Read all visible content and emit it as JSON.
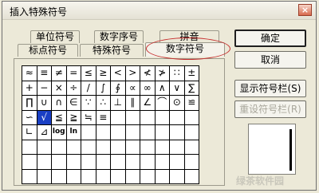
{
  "dialog": {
    "title": "插入特殊符号",
    "close_label": "×"
  },
  "tabs": [
    {
      "label": "单位符号"
    },
    {
      "label": "数字序号"
    },
    {
      "label": "拼音"
    },
    {
      "label": "标点符号"
    },
    {
      "label": "特殊符号"
    },
    {
      "label": "数字符号"
    }
  ],
  "symbols": [
    [
      "≈",
      "≡",
      "≠",
      "=",
      "≤",
      "≥",
      "<",
      ">",
      "≮",
      "≯",
      "∷",
      "±"
    ],
    [
      "+",
      "−",
      "×",
      "÷",
      "/",
      "∫",
      "∮",
      "∝",
      "∞",
      "∧",
      "∨",
      "∑"
    ],
    [
      "∏",
      "∪",
      "∩",
      "∈",
      "∵",
      "∴",
      "⊥",
      "∥",
      "∠",
      "⌒",
      "⊙",
      "≌"
    ],
    [
      "∽",
      "√",
      "≦",
      "≧",
      "≒",
      "≡",
      "",
      "",
      "",
      "",
      "",
      ""
    ],
    [
      "∟",
      "⊿",
      "log",
      "ln",
      "",
      "",
      "",
      "",
      "",
      "",
      "",
      ""
    ],
    [
      "",
      "",
      "",
      "",
      "",
      "",
      "",
      "",
      "",
      "",
      "",
      ""
    ],
    [
      "",
      "",
      "",
      "",
      "",
      "",
      "",
      "",
      "",
      "",
      "",
      ""
    ],
    [
      "",
      "",
      "",
      "",
      "",
      "",
      "",
      "",
      "",
      "",
      "",
      ""
    ]
  ],
  "buttons": {
    "ok": "确定",
    "cancel": "取消",
    "show_toolbar": "显示符号栏(S)",
    "reset_toolbar": "重设符号栏(R)"
  },
  "watermark": "绿茶软件园"
}
